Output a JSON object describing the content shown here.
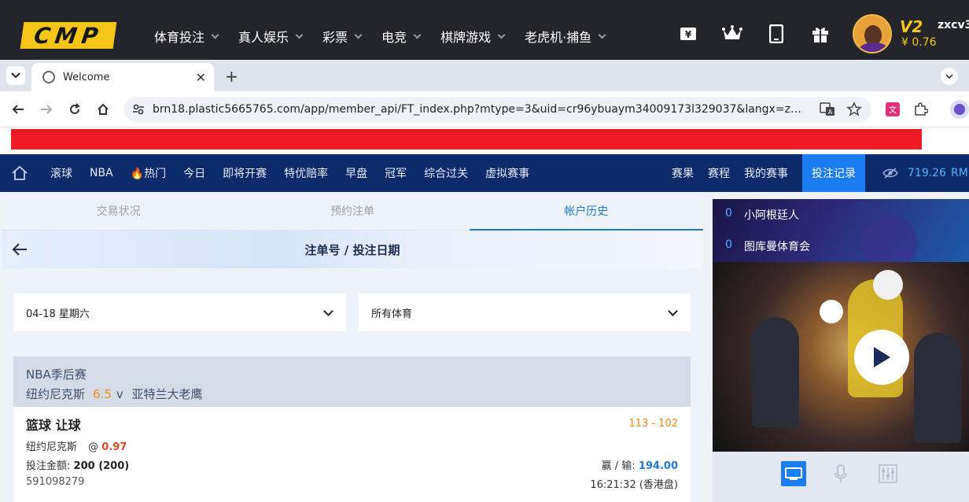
{
  "site_nav": {
    "logo": "CMP",
    "items": [
      "体育投注",
      "真人娱乐",
      "彩票",
      "电竞",
      "棋牌游戏",
      "老虎机·捕鱼"
    ],
    "icons": [
      "yen-icon",
      "crown-icon",
      "tablet-icon",
      "gift-icon"
    ],
    "vip_level": "V2",
    "balance": "¥ 0.76",
    "username": "zxcv3"
  },
  "browser": {
    "tab_title": "Welcome",
    "new_tab": "+",
    "url": "brn18.plastic5665765.com/app/member_api/FT_index.php?mtype=3&uid=cr96ybuaym34009173l329037&langx=zh-cn&n..."
  },
  "sub_nav": {
    "left_items": [
      "滚球",
      "NBA",
      "热门",
      "今日",
      "即将开赛",
      "特优赔率",
      "早盘",
      "冠军",
      "综合过关",
      "虚拟赛事"
    ],
    "right_items": [
      "赛果",
      "赛程",
      "我的赛事"
    ],
    "bet_record": "投注记录",
    "balance": "719.26",
    "currency": "RM"
  },
  "main": {
    "tabs": [
      "交易状况",
      "预约注单",
      "帐户历史"
    ],
    "active_tab": "帐户历史",
    "title": "注单号 / 投注日期",
    "date_select": "04-18 星期六",
    "sport_select": "所有体育",
    "bet": {
      "league": "NBA季后赛",
      "home": "纽约尼克斯",
      "handicap": "6.5",
      "vs": "v",
      "away": "亚特兰大老鹰",
      "market": "篮球 让球",
      "score": "113 - 102",
      "pick": "纽约尼克斯",
      "at": "@",
      "odds": "0.97",
      "stake_label": "投注金额:",
      "stake": "200 (200)",
      "winloss_label": "赢 / 输:",
      "winloss": "194.00",
      "ticket_id": "591098279",
      "time": "16:21:32 (香港盘)"
    }
  },
  "side": {
    "live_matches": [
      {
        "count": "0",
        "team": "小阿根廷人"
      },
      {
        "count": "0",
        "team": "图库曼体育会"
      }
    ],
    "controls": [
      "tv-icon",
      "mic-icon",
      "sliders-icon"
    ]
  }
}
